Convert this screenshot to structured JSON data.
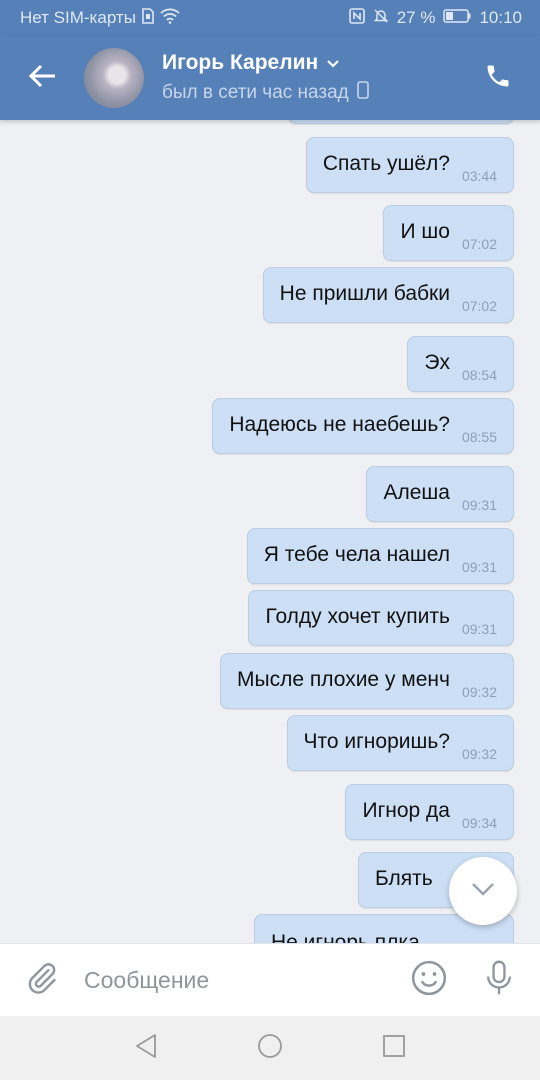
{
  "status_bar": {
    "carrier": "Нет SIM-карты",
    "battery": "27 %",
    "time": "10:10"
  },
  "header": {
    "contact_name": "Игорь Карелин",
    "last_seen": "был в сети час назад"
  },
  "messages": [
    {
      "text": "Спать ушёл?",
      "time": "03:44"
    },
    {
      "text": "И шо",
      "time": "07:02"
    },
    {
      "text": "Не пришли бабки",
      "time": "07:02"
    },
    {
      "text": "Эх",
      "time": "08:54"
    },
    {
      "text": "Надеюсь не наебешь?",
      "time": "08:55"
    },
    {
      "text": "Алеша",
      "time": "09:31"
    },
    {
      "text": "Я тебе чела нашел",
      "time": "09:31"
    },
    {
      "text": "Голду хочет купить",
      "time": "09:31"
    },
    {
      "text": "Мысле плохие у менч",
      "time": "09:32"
    },
    {
      "text": "Что игноришь?",
      "time": "09:32"
    },
    {
      "text": "Игнор да",
      "time": "09:34"
    },
    {
      "text": "Блять",
      "time": ""
    },
    {
      "text": "Не игнорь плка",
      "time": ""
    }
  ],
  "composer": {
    "placeholder": "Сообщение"
  },
  "colors": {
    "header": "#5580b8",
    "bubble": "#cddff5",
    "background": "#eef0f3"
  }
}
